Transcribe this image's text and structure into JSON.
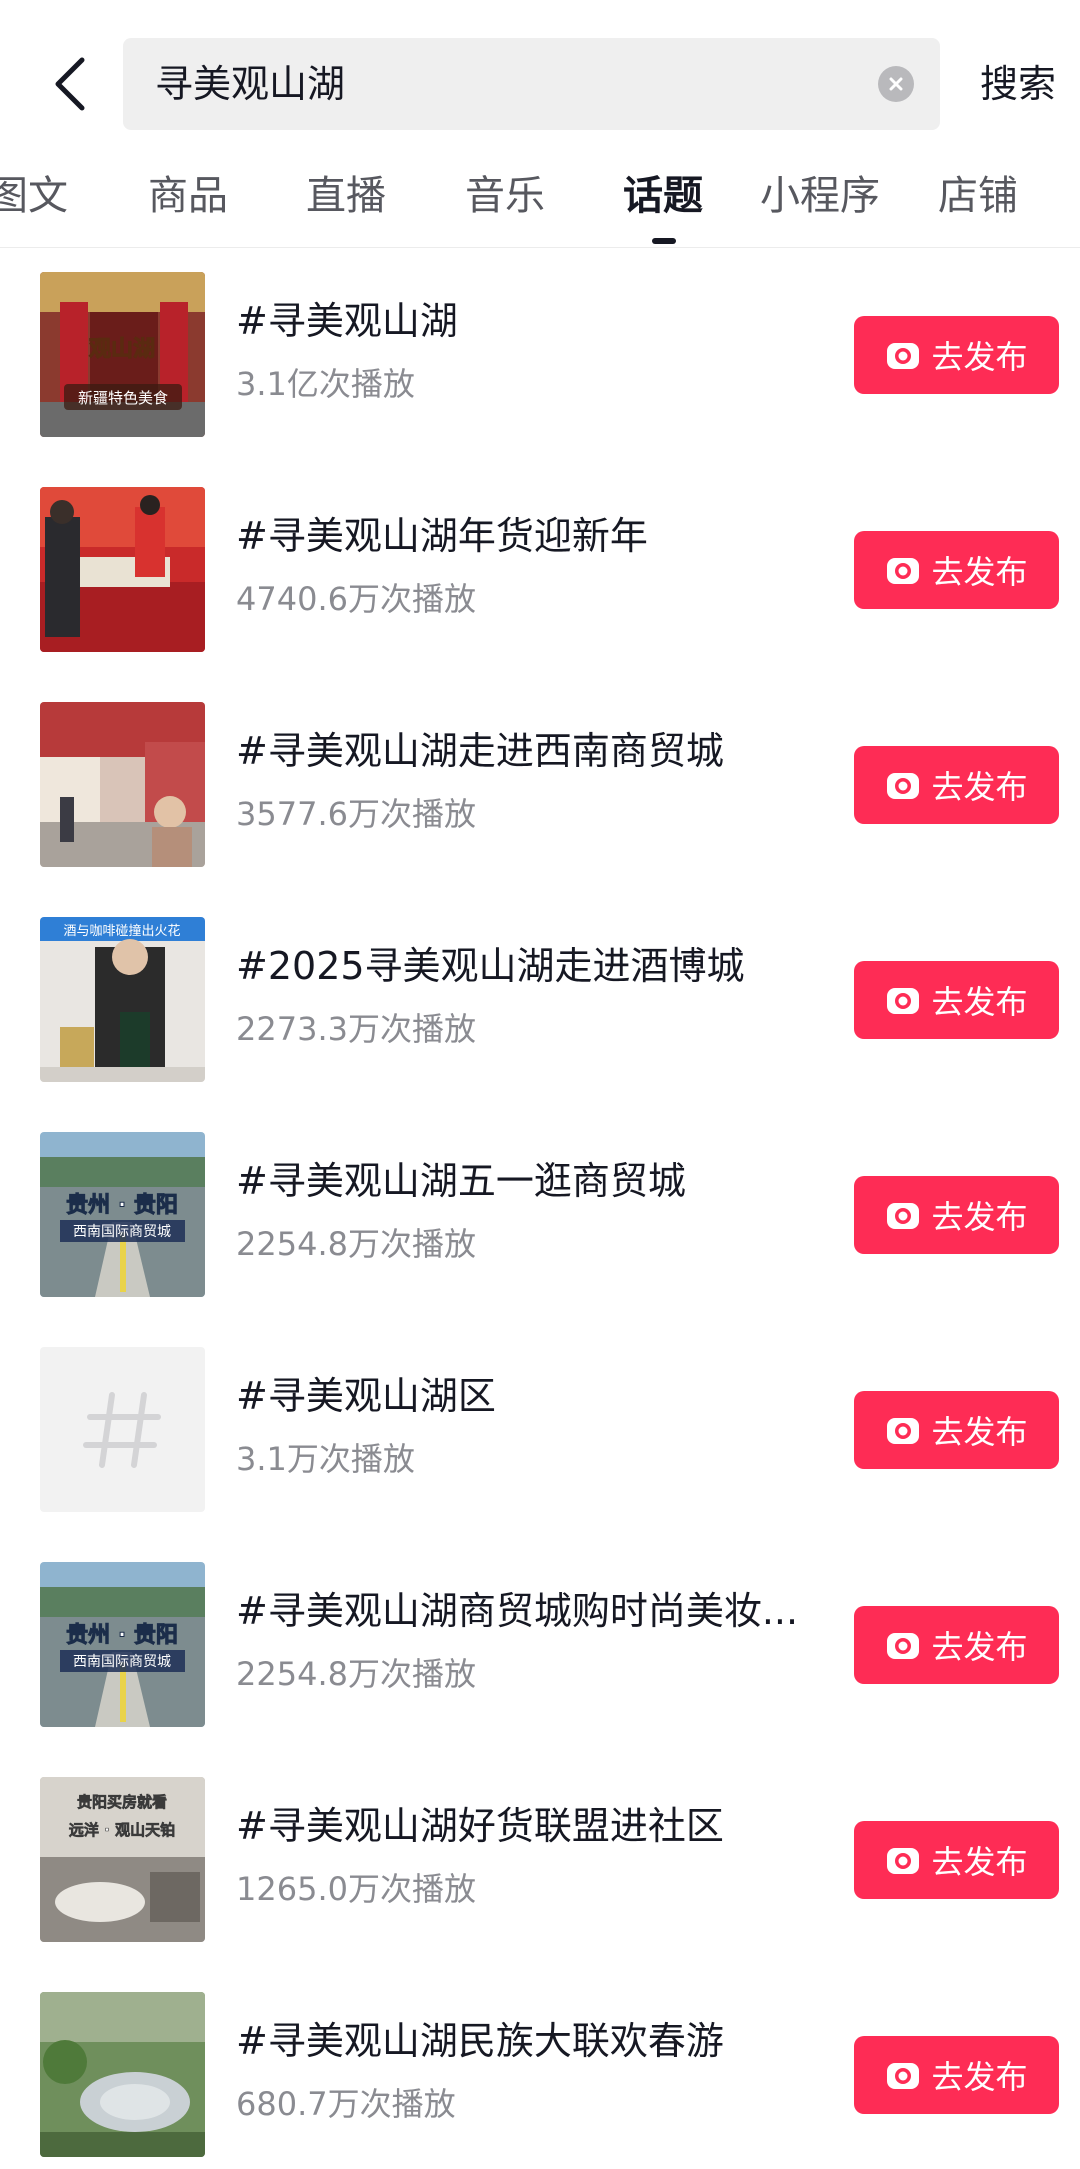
{
  "search": {
    "query": "寻美观山湖",
    "submit_label": "搜索"
  },
  "tabs": [
    {
      "label": "图文"
    },
    {
      "label": "商品"
    },
    {
      "label": "直播"
    },
    {
      "label": "音乐"
    },
    {
      "label": "话题",
      "active": true
    },
    {
      "label": "小程序"
    },
    {
      "label": "店铺"
    }
  ],
  "topics": [
    {
      "title": "#寻美观山湖",
      "plays": "3.1亿次播放",
      "thumb_text": [
        "观山湖",
        "新疆特色美食"
      ]
    },
    {
      "title": "#寻美观山湖年货迎新年",
      "plays": "4740.6万次播放",
      "thumb_text": []
    },
    {
      "title": "#寻美观山湖走进西南商贸城",
      "plays": "3577.6万次播放",
      "thumb_text": []
    },
    {
      "title": "#2025寻美观山湖走进酒博城",
      "plays": "2273.3万次播放",
      "thumb_text": [
        "酒与咖啡碰撞出火花"
      ]
    },
    {
      "title": "#寻美观山湖五一逛商贸城",
      "plays": "2254.8万次播放",
      "thumb_text": [
        "贵州 · 贵阳",
        "西南国际商贸城"
      ]
    },
    {
      "title": "#寻美观山湖区",
      "plays": "3.1万次播放",
      "thumb_text": []
    },
    {
      "title": "#寻美观山湖商贸城购时尚美妆...",
      "plays": "2254.8万次播放",
      "thumb_text": [
        "贵州 · 贵阳",
        "西南国际商贸城"
      ]
    },
    {
      "title": "#寻美观山湖好货联盟进社区",
      "plays": "1265.0万次播放",
      "thumb_text": [
        "贵阳买房就看",
        "远洋 · 观山天铂"
      ]
    },
    {
      "title": "#寻美观山湖民族大联欢春游",
      "plays": "680.7万次播放",
      "thumb_text": []
    }
  ],
  "publish_label": "去发布",
  "icons": {
    "back": "chevron-left-icon",
    "clear": "close-circle-icon",
    "publish": "camera-icon",
    "placeholder": "hashtag-icon"
  },
  "colors": {
    "accent": "#fe2c55",
    "text_primary": "#161823",
    "text_secondary": "#8a8b91"
  }
}
